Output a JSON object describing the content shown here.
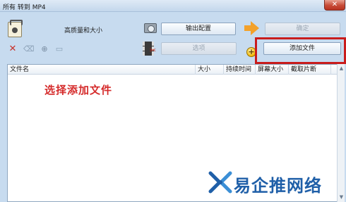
{
  "window": {
    "title": "所有 转到 MP4",
    "close_glyph": "✕"
  },
  "toolbar": {
    "quality_label": "高质量和大小",
    "output_config_label": "输出配置",
    "confirm_label": "确定",
    "options_label": "选项",
    "add_file_label": "添加文件",
    "add_glyph": "+",
    "scissors_glyph": "✂",
    "arrow_icon_color": "#f3a12a",
    "tools": {
      "delete_glyph": "✕",
      "clear_glyph": "⌫",
      "play_glyph": "⊕",
      "view_glyph": "▭"
    }
  },
  "highlight": {
    "color": "#c91c1c"
  },
  "file_table": {
    "columns": [
      "文件名",
      "大小",
      "持续时间",
      "屏幕大小",
      "截取片断"
    ],
    "hint": "选择添加文件"
  },
  "scrollbar": {
    "up_glyph": "▲",
    "down_glyph": "▼"
  },
  "watermark": {
    "text": "易企推网络",
    "logo_color": "#1f5fa8"
  }
}
